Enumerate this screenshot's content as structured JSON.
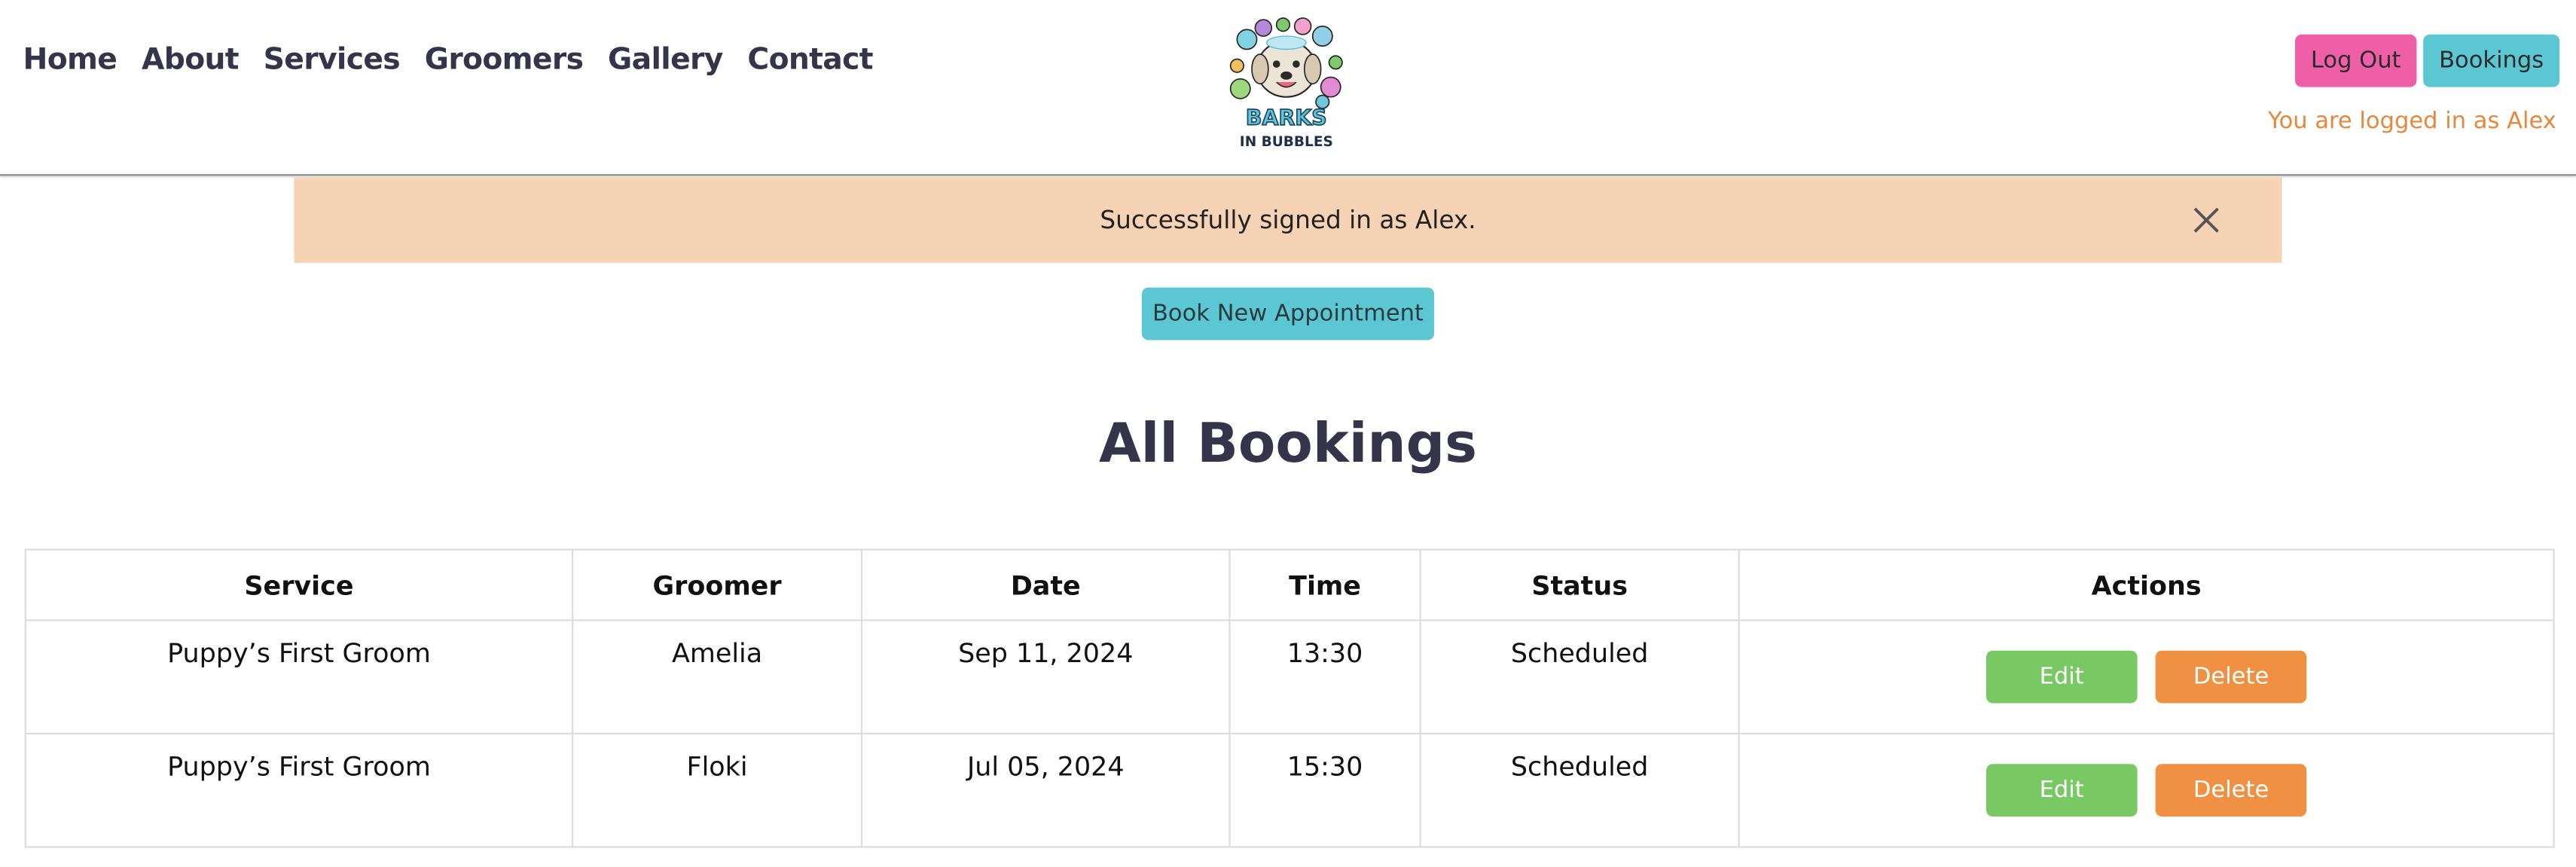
{
  "nav": {
    "items": [
      "Home",
      "About",
      "Services",
      "Groomers",
      "Gallery",
      "Contact"
    ]
  },
  "logo": {
    "line1": "BARKS",
    "line2": "IN BUBBLES",
    "icon": "dog-with-bubbles-logo"
  },
  "header": {
    "logout_label": "Log Out",
    "bookings_label": "Bookings",
    "logged_in_text": "You are logged in as Alex"
  },
  "alert": {
    "message": "Successfully signed in as Alex.",
    "close_icon": "close-icon"
  },
  "main": {
    "book_button": "Book New Appointment",
    "title": "All Bookings"
  },
  "table": {
    "headers": [
      "Service",
      "Groomer",
      "Date",
      "Time",
      "Status",
      "Actions"
    ],
    "rows": [
      {
        "service": "Puppy’s First Groom",
        "groomer": "Amelia",
        "date": "Sep 11, 2024",
        "time": "13:30",
        "status": "Scheduled",
        "edit": "Edit",
        "delete": "Delete"
      },
      {
        "service": "Puppy’s First Groom",
        "groomer": "Floki",
        "date": "Jul 05, 2024",
        "time": "15:30",
        "status": "Scheduled",
        "edit": "Edit",
        "delete": "Delete"
      }
    ]
  },
  "colors": {
    "nav_text": "#36344a",
    "logout": "#ee5fa8",
    "bookings": "#5bc7d3",
    "logged_in_text": "#e6873c",
    "alert_bg": "#f7d3b5",
    "edit": "#78c964",
    "delete": "#ef9043"
  }
}
